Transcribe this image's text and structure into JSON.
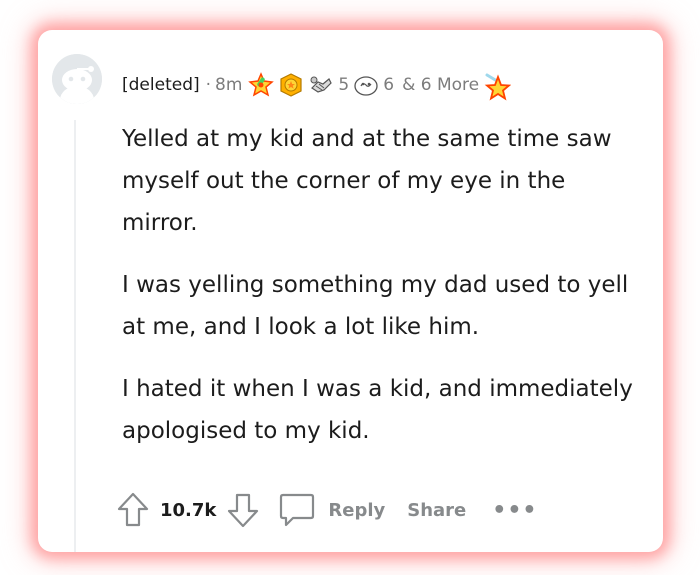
{
  "comment": {
    "author": "[deleted]",
    "separator": "·",
    "age": "8m",
    "awards": [
      {
        "icon": "rocket-award-icon",
        "count": ""
      },
      {
        "icon": "gold-badge-award-icon",
        "count": ""
      },
      {
        "icon": "handshake-award-icon",
        "count": "5"
      },
      {
        "icon": "swirl-face-award-icon",
        "count": "6"
      },
      {
        "icon": "star-award-icon",
        "count": ""
      }
    ],
    "more_awards": "& 6 More",
    "paragraphs": [
      "Yelled at my kid and at the same time saw myself out the corner of my eye in the mirror.",
      "I was yelling something my dad used to yell at me, and I look a lot like him.",
      "I hated it when I was a kid, and immediately apologised to my kid."
    ]
  },
  "actions": {
    "score": "10.7k",
    "reply": "Reply",
    "share": "Share",
    "more": "•••"
  },
  "colors": {
    "glow": "#ff6e6e",
    "muted_text": "#7c7c7c",
    "action_text": "#878a8c",
    "avatar_bg": "#e3e7ea"
  }
}
